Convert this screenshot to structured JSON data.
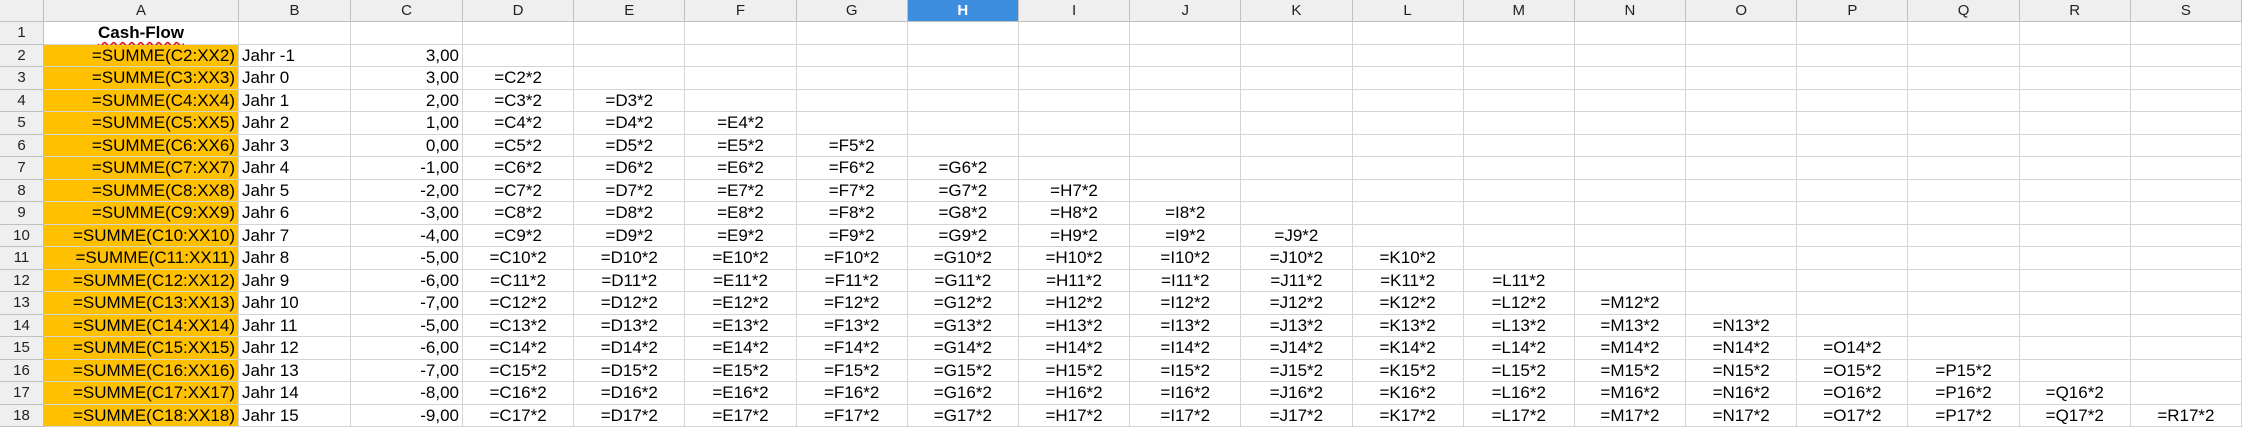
{
  "sheet": {
    "columns": [
      "A",
      "B",
      "C",
      "D",
      "E",
      "F",
      "G",
      "H",
      "I",
      "J",
      "K",
      "L",
      "M",
      "N",
      "O",
      "P",
      "Q",
      "R",
      "S"
    ],
    "selected_column": "H",
    "title_cell": "Cash-Flow",
    "rows": [
      {
        "num": "1"
      },
      {
        "num": "2",
        "a": "=SUMME(C2:XX2)",
        "b": "Jahr -1",
        "c": "3,00",
        "formulas": []
      },
      {
        "num": "3",
        "a": "=SUMME(C3:XX3)",
        "b": "Jahr 0",
        "c": "3,00",
        "formulas": [
          "=C2*2"
        ]
      },
      {
        "num": "4",
        "a": "=SUMME(C4:XX4)",
        "b": "Jahr 1",
        "c": "2,00",
        "formulas": [
          "=C3*2",
          "=D3*2"
        ]
      },
      {
        "num": "5",
        "a": "=SUMME(C5:XX5)",
        "b": "Jahr 2",
        "c": "1,00",
        "formulas": [
          "=C4*2",
          "=D4*2",
          "=E4*2"
        ]
      },
      {
        "num": "6",
        "a": "=SUMME(C6:XX6)",
        "b": "Jahr 3",
        "c": "0,00",
        "formulas": [
          "=C5*2",
          "=D5*2",
          "=E5*2",
          "=F5*2"
        ]
      },
      {
        "num": "7",
        "a": "=SUMME(C7:XX7)",
        "b": "Jahr 4",
        "c": "-1,00",
        "formulas": [
          "=C6*2",
          "=D6*2",
          "=E6*2",
          "=F6*2",
          "=G6*2"
        ]
      },
      {
        "num": "8",
        "a": "=SUMME(C8:XX8)",
        "b": "Jahr 5",
        "c": "-2,00",
        "formulas": [
          "=C7*2",
          "=D7*2",
          "=E7*2",
          "=F7*2",
          "=G7*2",
          "=H7*2"
        ]
      },
      {
        "num": "9",
        "a": "=SUMME(C9:XX9)",
        "b": "Jahr 6",
        "c": "-3,00",
        "formulas": [
          "=C8*2",
          "=D8*2",
          "=E8*2",
          "=F8*2",
          "=G8*2",
          "=H8*2",
          "=I8*2"
        ]
      },
      {
        "num": "10",
        "a": "=SUMME(C10:XX10)",
        "b": "Jahr 7",
        "c": "-4,00",
        "formulas": [
          "=C9*2",
          "=D9*2",
          "=E9*2",
          "=F9*2",
          "=G9*2",
          "=H9*2",
          "=I9*2",
          "=J9*2"
        ]
      },
      {
        "num": "11",
        "a": "=SUMME(C11:XX11)",
        "b": "Jahr 8",
        "c": "-5,00",
        "formulas": [
          "=C10*2",
          "=D10*2",
          "=E10*2",
          "=F10*2",
          "=G10*2",
          "=H10*2",
          "=I10*2",
          "=J10*2",
          "=K10*2"
        ]
      },
      {
        "num": "12",
        "a": "=SUMME(C12:XX12)",
        "b": "Jahr 9",
        "c": "-6,00",
        "formulas": [
          "=C11*2",
          "=D11*2",
          "=E11*2",
          "=F11*2",
          "=G11*2",
          "=H11*2",
          "=I11*2",
          "=J11*2",
          "=K11*2",
          "=L11*2"
        ]
      },
      {
        "num": "13",
        "a": "=SUMME(C13:XX13)",
        "b": "Jahr 10",
        "c": "-7,00",
        "formulas": [
          "=C12*2",
          "=D12*2",
          "=E12*2",
          "=F12*2",
          "=G12*2",
          "=H12*2",
          "=I12*2",
          "=J12*2",
          "=K12*2",
          "=L12*2",
          "=M12*2"
        ]
      },
      {
        "num": "14",
        "a": "=SUMME(C14:XX14)",
        "b": "Jahr 11",
        "c": "-5,00",
        "formulas": [
          "=C13*2",
          "=D13*2",
          "=E13*2",
          "=F13*2",
          "=G13*2",
          "=H13*2",
          "=I13*2",
          "=J13*2",
          "=K13*2",
          "=L13*2",
          "=M13*2",
          "=N13*2"
        ]
      },
      {
        "num": "15",
        "a": "=SUMME(C15:XX15)",
        "b": "Jahr 12",
        "c": "-6,00",
        "formulas": [
          "=C14*2",
          "=D14*2",
          "=E14*2",
          "=F14*2",
          "=G14*2",
          "=H14*2",
          "=I14*2",
          "=J14*2",
          "=K14*2",
          "=L14*2",
          "=M14*2",
          "=N14*2",
          "=O14*2"
        ]
      },
      {
        "num": "16",
        "a": "=SUMME(C16:XX16)",
        "b": "Jahr 13",
        "c": "-7,00",
        "formulas": [
          "=C15*2",
          "=D15*2",
          "=E15*2",
          "=F15*2",
          "=G15*2",
          "=H15*2",
          "=I15*2",
          "=J15*2",
          "=K15*2",
          "=L15*2",
          "=M15*2",
          "=N15*2",
          "=O15*2",
          "=P15*2"
        ]
      },
      {
        "num": "17",
        "a": "=SUMME(C17:XX17)",
        "b": "Jahr 14",
        "c": "-8,00",
        "formulas": [
          "=C16*2",
          "=D16*2",
          "=E16*2",
          "=F16*2",
          "=G16*2",
          "=H16*2",
          "=I16*2",
          "=J16*2",
          "=K16*2",
          "=L16*2",
          "=M16*2",
          "=N16*2",
          "=O16*2",
          "=P16*2",
          "=Q16*2"
        ]
      },
      {
        "num": "18",
        "a": "=SUMME(C18:XX18)",
        "b": "Jahr 15",
        "c": "-9,00",
        "formulas": [
          "=C17*2",
          "=D17*2",
          "=E17*2",
          "=F17*2",
          "=G17*2",
          "=H17*2",
          "=I17*2",
          "=J17*2",
          "=K17*2",
          "=L17*2",
          "=M17*2",
          "=N17*2",
          "=O17*2",
          "=P17*2",
          "=Q17*2",
          "=R17*2"
        ]
      }
    ]
  },
  "colors": {
    "highlight_fill": "#ffc000",
    "selected_header": "#3d8ede"
  }
}
